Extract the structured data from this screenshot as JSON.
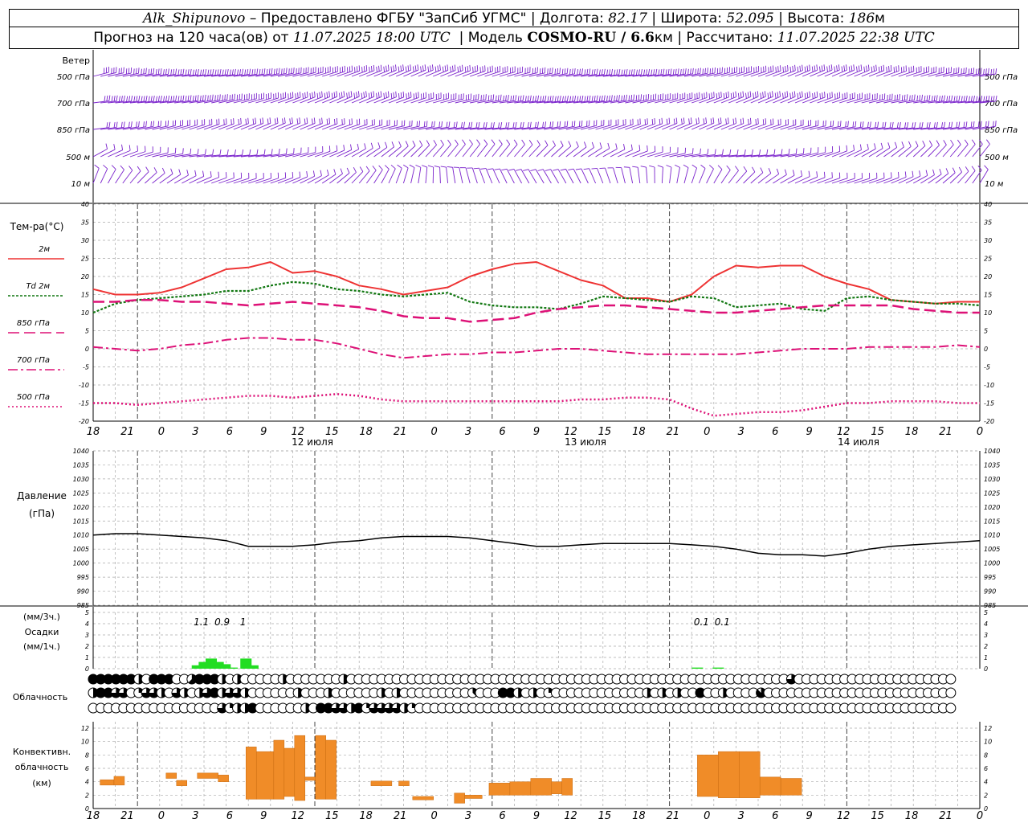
{
  "header": {
    "station": "Alk_Shipunovo",
    "provider": "– Предоставлено ФГБУ \"ЗапСиб УГМС\"",
    "sep": "|",
    "lon_label": "Долгота:",
    "lon_value": "82.17",
    "lat_label": "Широта:",
    "lat_value": "52.095",
    "alt_label": "Высота:",
    "alt_value": "186",
    "alt_unit": "м",
    "forecast_label": "Прогноз на 120 часа(ов) от",
    "forecast_start": "11.07.2025 18:00 UTC",
    "model_label": "Модель",
    "model_name": "COSMO-RU / 6.6",
    "model_unit": "км",
    "calc_label": "Рассчитано:",
    "calc_time": "11.07.2025 22:38 UTC"
  },
  "labels": {
    "wind_title": "Ветер",
    "wind_levels": [
      "500 гПа",
      "700 гПа",
      "850 гПа",
      "500 м",
      "10 м"
    ],
    "temp_title": "Тем-ра(°С)",
    "temp_legend": [
      "2м",
      "Td 2м",
      "850 гПа",
      "700 гПа",
      "500 гПа"
    ],
    "pressure_title": [
      "Давление",
      "(гПа)"
    ],
    "precip_title": [
      "(мм/3ч.)",
      "Осадки",
      "(мм/1ч.)"
    ],
    "cloud_title": "Облачность",
    "conv_title": [
      "Конвективн.",
      "облачность",
      "(км)"
    ]
  },
  "colors": {
    "wind": "#7a22cc",
    "t2m": "#ee3333",
    "td2m": "#117711",
    "t850": "#dd1177",
    "t700": "#dd1177",
    "t500": "#dd1177",
    "precip": "#22dd22",
    "convective": "#f08c28"
  },
  "chart_data": [
    {
      "type": "line",
      "name": "wind_barbs",
      "ylabel": "Ветер",
      "levels": [
        "500 гПа",
        "700 гПа",
        "850 гПа",
        "500 м",
        "10 м"
      ]
    },
    {
      "type": "line",
      "ylabel": "Тем-ра(°С)",
      "ylim": [
        -20,
        40
      ],
      "yticks": [
        -20,
        -15,
        -10,
        -5,
        0,
        5,
        10,
        15,
        20,
        25,
        30,
        35,
        40
      ],
      "x_hours": [
        0,
        3,
        6,
        9,
        12,
        15,
        18,
        21,
        24,
        27,
        30,
        33,
        36,
        39,
        42,
        45,
        48,
        51,
        54,
        57,
        60,
        63,
        66,
        69,
        72,
        75,
        78,
        81,
        84,
        87,
        90,
        93,
        96,
        99,
        102,
        105,
        108,
        111,
        114,
        117,
        120
      ],
      "xtick_labels": [
        "18",
        "21",
        "0",
        "3",
        "6",
        "9",
        "12",
        "15",
        "18",
        "21",
        "0",
        "3",
        "6",
        "9",
        "12",
        "15",
        "18",
        "21",
        "0",
        "3",
        "6",
        "9",
        "12",
        "15",
        "18",
        "21",
        "0"
      ],
      "day_labels": [
        "12 июля",
        "13 июля",
        "14 июля"
      ],
      "series": [
        {
          "name": "2м",
          "values": [
            16.5,
            15,
            15,
            15.5,
            17,
            19.5,
            22,
            22.5,
            24,
            21,
            21.5,
            20,
            17.5,
            16.5,
            15,
            16,
            17,
            20,
            22,
            23.5,
            24,
            21.5,
            19,
            17.5,
            14,
            14,
            13,
            15,
            20,
            23,
            22.5,
            23,
            23,
            20,
            18,
            16.5,
            13.5,
            13,
            12.5,
            13,
            13
          ]
        },
        {
          "name": "Td 2м",
          "values": [
            10,
            12.5,
            13.5,
            14,
            14.5,
            15,
            16,
            16,
            17.5,
            18.5,
            18,
            16.5,
            16,
            15,
            14.5,
            15,
            15.5,
            13,
            12,
            11.5,
            11.5,
            11,
            12.5,
            14.5,
            14,
            13.5,
            13,
            14.5,
            14,
            11.5,
            12,
            12.5,
            11,
            10.5,
            14,
            14.5,
            13.5,
            13,
            12.5,
            12.5,
            12
          ]
        },
        {
          "name": "850 гПа",
          "values": [
            13,
            13,
            13.5,
            13.5,
            13,
            13,
            12.5,
            12,
            12.5,
            13,
            12.5,
            12,
            11.5,
            10.5,
            9,
            8.5,
            8.5,
            7.5,
            8,
            8.5,
            10,
            11,
            11.5,
            12,
            12,
            11.5,
            11,
            10.5,
            10,
            10,
            10.5,
            11,
            11.5,
            12,
            12,
            12,
            12,
            11,
            10.5,
            10,
            10
          ]
        },
        {
          "name": "700 гПа",
          "values": [
            0.5,
            0,
            -0.5,
            0,
            1,
            1.5,
            2.5,
            3,
            3,
            2.5,
            2.5,
            1.5,
            0,
            -1.5,
            -2.5,
            -2,
            -1.5,
            -1.5,
            -1,
            -1,
            -0.5,
            0,
            0,
            -0.5,
            -1,
            -1.5,
            -1.5,
            -1.5,
            -1.5,
            -1.5,
            -1,
            -0.5,
            0,
            0,
            0,
            0.5,
            0.5,
            0.5,
            0.5,
            1,
            0.5
          ]
        },
        {
          "name": "500 гПа",
          "values": [
            -15,
            -15,
            -15.5,
            -15,
            -14.5,
            -14,
            -13.5,
            -13,
            -13,
            -13.5,
            -13,
            -12.5,
            -13,
            -14,
            -14.5,
            -14.5,
            -14.5,
            -14.5,
            -14.5,
            -14.5,
            -14.5,
            -14.5,
            -14,
            -14,
            -13.5,
            -13.5,
            -14,
            -16.5,
            -18.5,
            -18,
            -17.5,
            -17.5,
            -17,
            -16,
            -15,
            -15,
            -14.5,
            -14.5,
            -14.5,
            -15,
            -15
          ]
        }
      ]
    },
    {
      "type": "line",
      "ylabel": "Давление (гПа)",
      "ylim": [
        985,
        1040
      ],
      "yticks": [
        985,
        990,
        995,
        1000,
        1005,
        1010,
        1015,
        1020,
        1025,
        1030,
        1035,
        1040
      ],
      "series": [
        {
          "name": "pressure",
          "values": [
            1010,
            1010.5,
            1010.5,
            1010,
            1009.5,
            1009,
            1008,
            1006,
            1006,
            1006,
            1006.5,
            1007.5,
            1008,
            1009,
            1009.5,
            1009.5,
            1009.5,
            1009,
            1008,
            1007,
            1006,
            1006,
            1006.5,
            1007,
            1007,
            1007,
            1007,
            1006.5,
            1006,
            1005,
            1003.5,
            1003,
            1003,
            1002.5,
            1003.5,
            1005,
            1006,
            1006.5,
            1007,
            1007.5,
            1008
          ]
        }
      ]
    },
    {
      "type": "bar",
      "ylabel": "Осадки (мм/3ч.) (мм/1ч.)",
      "ylim": [
        0,
        5
      ],
      "yticks": [
        0,
        1,
        2,
        3,
        4,
        5
      ],
      "values_3h_labels": [
        {
          "x": 15,
          "text": "1.1"
        },
        {
          "x": 18,
          "text": "0.9"
        },
        {
          "x": 21,
          "text": "1"
        },
        {
          "x": 87,
          "text": "0.1"
        },
        {
          "x": 90,
          "text": "0.1"
        }
      ],
      "bars_1h": [
        {
          "x": 15,
          "value": 0.3
        },
        {
          "x": 16,
          "value": 0.6
        },
        {
          "x": 17,
          "value": 0.9
        },
        {
          "x": 18,
          "value": 0.6
        },
        {
          "x": 19,
          "value": 0.4
        },
        {
          "x": 20,
          "value": 0.1
        },
        {
          "x": 22,
          "value": 0.9
        },
        {
          "x": 23,
          "value": 0.3
        },
        {
          "x": 87,
          "value": 0.1
        },
        {
          "x": 90,
          "value": 0.1
        }
      ]
    },
    {
      "type": "table",
      "name": "Облачность",
      "rows": [
        [
          8,
          8,
          8,
          8,
          8,
          8,
          4,
          0,
          8,
          8,
          8,
          0,
          0,
          5,
          8,
          8,
          8,
          4,
          0,
          4,
          0,
          0,
          0,
          0,
          0,
          4,
          0,
          0,
          0,
          0,
          0,
          0,
          0,
          4,
          0,
          0,
          0,
          0,
          0,
          0,
          0,
          0,
          0,
          0,
          0,
          0,
          0,
          0,
          0,
          0,
          0,
          0,
          0,
          0,
          0,
          0,
          0,
          0,
          0,
          0,
          0,
          0,
          0,
          0,
          0,
          0,
          0,
          0,
          0,
          0,
          0,
          0,
          0,
          0,
          0,
          0,
          0,
          0,
          0,
          0,
          0,
          0,
          0,
          0,
          0,
          0,
          0,
          0,
          0,
          0,
          0,
          0,
          6,
          0,
          0,
          0,
          0,
          0,
          0,
          0,
          0,
          0,
          0,
          0,
          0,
          0,
          0,
          0,
          0,
          0,
          0,
          0,
          0,
          0,
          0,
          0,
          0,
          0
        ],
        [
          4,
          8,
          8,
          6,
          6,
          0,
          2,
          6,
          6,
          4,
          0,
          6,
          4,
          0,
          4,
          6,
          8,
          4,
          6,
          6,
          4,
          0,
          0,
          0,
          0,
          0,
          0,
          4,
          0,
          0,
          0,
          4,
          0,
          0,
          0,
          0,
          0,
          0,
          4,
          0,
          4,
          0,
          0,
          0,
          0,
          0,
          0,
          0,
          0,
          0,
          3,
          0,
          0,
          0,
          8,
          8,
          4,
          0,
          4,
          0,
          2,
          0,
          0,
          0,
          0,
          0,
          0,
          0,
          0,
          0,
          0,
          0,
          0,
          4,
          0,
          4,
          0,
          4,
          0,
          0,
          8,
          0,
          0,
          4,
          0,
          0,
          0,
          0,
          7,
          0,
          0,
          0,
          0,
          0,
          0,
          0,
          0,
          0,
          0,
          0,
          0,
          0,
          0,
          0,
          0,
          0,
          0,
          0,
          0,
          0,
          0,
          0,
          0,
          0,
          0,
          0
        ],
        [
          0,
          0,
          0,
          0,
          0,
          0,
          0,
          0,
          0,
          0,
          0,
          0,
          0,
          0,
          0,
          0,
          0,
          6,
          2,
          4,
          4,
          8,
          0,
          0,
          0,
          0,
          0,
          0,
          4,
          0,
          8,
          8,
          6,
          6,
          4,
          8,
          2,
          6,
          6,
          6,
          6,
          4,
          2,
          0,
          0,
          0,
          0,
          0,
          0,
          0,
          0,
          0,
          0,
          0,
          0,
          0,
          0,
          0,
          0,
          0,
          0,
          0,
          0,
          0,
          0,
          0,
          0,
          0,
          0,
          0,
          0,
          0,
          0,
          0,
          0,
          0,
          0,
          0,
          0,
          0,
          0,
          0,
          0,
          0,
          0,
          0,
          0,
          0,
          0,
          0,
          0,
          0,
          0,
          0,
          0,
          0,
          0,
          0,
          0,
          0,
          0,
          0,
          0,
          0,
          0,
          0,
          0,
          0,
          0,
          0,
          0,
          0,
          0,
          0,
          0,
          0,
          0,
          0
        ]
      ]
    },
    {
      "type": "bar",
      "ylabel": "Конвективн. облачность (км)",
      "ylim": [
        0,
        12
      ],
      "yticks": [
        0,
        2,
        4,
        6,
        8,
        10,
        12
      ],
      "bars": [
        {
          "x0": 1,
          "x1": 3,
          "bottom": 3.5,
          "top": 4.3
        },
        {
          "x0": 3,
          "x1": 4.5,
          "bottom": 3.5,
          "top": 4.8
        },
        {
          "x0": 10.5,
          "x1": 12,
          "bottom": 4.5,
          "top": 5.3
        },
        {
          "x0": 12,
          "x1": 13.5,
          "bottom": 3.4,
          "top": 4.2
        },
        {
          "x0": 15,
          "x1": 18,
          "bottom": 4.5,
          "top": 5.3
        },
        {
          "x0": 18,
          "x1": 19.5,
          "bottom": 4.0,
          "top": 5.0
        },
        {
          "x0": 22,
          "x1": 23.5,
          "bottom": 1.4,
          "top": 9.2
        },
        {
          "x0": 23.5,
          "x1": 26,
          "bottom": 1.4,
          "top": 8.5
        },
        {
          "x0": 26,
          "x1": 27.5,
          "bottom": 1.4,
          "top": 10.2
        },
        {
          "x0": 27.5,
          "x1": 29,
          "bottom": 1.8,
          "top": 9.0
        },
        {
          "x0": 29,
          "x1": 30.5,
          "bottom": 1.2,
          "top": 10.9
        },
        {
          "x0": 30.5,
          "x1": 32,
          "bottom": 4.2,
          "top": 4.7
        },
        {
          "x0": 32,
          "x1": 33.5,
          "bottom": 1.4,
          "top": 10.9
        },
        {
          "x0": 33.5,
          "x1": 35,
          "bottom": 1.4,
          "top": 10.2
        },
        {
          "x0": 40,
          "x1": 43,
          "bottom": 3.4,
          "top": 4.1
        },
        {
          "x0": 44,
          "x1": 45.5,
          "bottom": 3.4,
          "top": 4.1
        },
        {
          "x0": 46,
          "x1": 49,
          "bottom": 1.3,
          "top": 1.8
        },
        {
          "x0": 52,
          "x1": 53.5,
          "bottom": 0.8,
          "top": 2.3
        },
        {
          "x0": 53.5,
          "x1": 56,
          "bottom": 1.5,
          "top": 2.0
        },
        {
          "x0": 57,
          "x1": 60,
          "bottom": 2.0,
          "top": 3.8
        },
        {
          "x0": 60,
          "x1": 63,
          "bottom": 2.0,
          "top": 4.0
        },
        {
          "x0": 63,
          "x1": 66,
          "bottom": 2.0,
          "top": 4.5
        },
        {
          "x0": 66,
          "x1": 67.5,
          "bottom": 2.2,
          "top": 4.0
        },
        {
          "x0": 67.5,
          "x1": 69,
          "bottom": 2.0,
          "top": 4.5
        },
        {
          "x0": 87,
          "x1": 90,
          "bottom": 1.8,
          "top": 8.0
        },
        {
          "x0": 90,
          "x1": 93,
          "bottom": 1.6,
          "top": 8.5
        },
        {
          "x0": 93,
          "x1": 96,
          "bottom": 1.6,
          "top": 8.5
        },
        {
          "x0": 96,
          "x1": 99,
          "bottom": 2.0,
          "top": 4.7
        },
        {
          "x0": 99,
          "x1": 102,
          "bottom": 2.0,
          "top": 4.5
        }
      ]
    }
  ]
}
